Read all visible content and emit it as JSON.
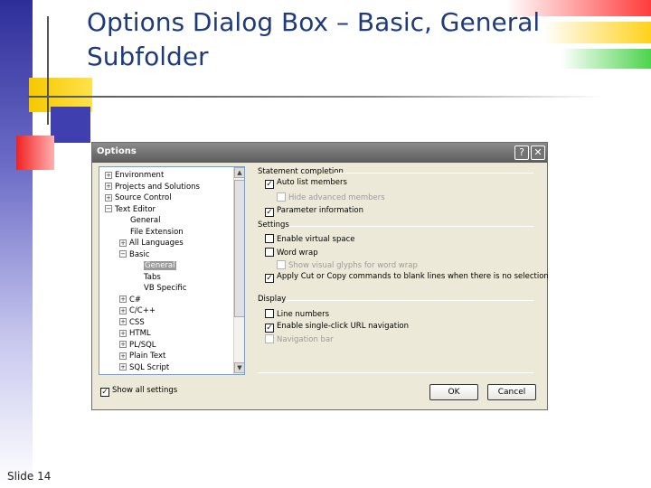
{
  "slide": {
    "title": "Options Dialog Box – Basic, General Subfolder",
    "footer": "Slide 14"
  },
  "dialog": {
    "title": "Options",
    "help_label": "?",
    "close_label": "✕",
    "tree": [
      {
        "label": "Environment",
        "expander": "+"
      },
      {
        "label": "Projects and Solutions",
        "expander": "+"
      },
      {
        "label": "Source Control",
        "expander": "+"
      },
      {
        "label": "Text Editor",
        "expander": "−"
      },
      {
        "label": "General",
        "expander": ""
      },
      {
        "label": "File Extension",
        "expander": ""
      },
      {
        "label": "All Languages",
        "expander": "+"
      },
      {
        "label": "Basic",
        "expander": "−"
      },
      {
        "label": "General",
        "expander": "",
        "selected": true
      },
      {
        "label": "Tabs",
        "expander": ""
      },
      {
        "label": "VB Specific",
        "expander": ""
      },
      {
        "label": "C#",
        "expander": "+"
      },
      {
        "label": "C/C++",
        "expander": "+"
      },
      {
        "label": "CSS",
        "expander": "+"
      },
      {
        "label": "HTML",
        "expander": "+"
      },
      {
        "label": "PL/SQL",
        "expander": "+"
      },
      {
        "label": "Plain Text",
        "expander": "+"
      },
      {
        "label": "SQL Script",
        "expander": "+"
      }
    ],
    "scroll_up": "▲",
    "scroll_down": "▼",
    "groups": {
      "statement_completion": "Statement completion",
      "settings": "Settings",
      "display": "Display"
    },
    "options": {
      "auto_list_members": {
        "label": "Auto list members",
        "checked": true
      },
      "hide_advanced_members": {
        "label": "Hide advanced members",
        "checked": false,
        "enabled": false
      },
      "parameter_information": {
        "label": "Parameter information",
        "checked": true
      },
      "enable_virtual_space": {
        "label": "Enable virtual space",
        "checked": false
      },
      "word_wrap": {
        "label": "Word wrap",
        "checked": false
      },
      "show_visual_glyphs": {
        "label": "Show visual glyphs for word wrap",
        "checked": false,
        "enabled": false
      },
      "apply_cut_copy": {
        "label": "Apply Cut or Copy commands to blank lines when there is no selection",
        "checked": true
      },
      "line_numbers": {
        "label": "Line numbers",
        "checked": false
      },
      "single_click_url": {
        "label": "Enable single-click URL navigation",
        "checked": true
      },
      "navigation_bar": {
        "label": "Navigation bar",
        "checked": false,
        "enabled": false
      }
    },
    "show_all_settings": {
      "label": "Show all settings",
      "checked": true
    },
    "ok_label": "OK",
    "cancel_label": "Cancel"
  },
  "colors": {
    "title_text": "#1f3b7a",
    "dialog_face": "#ece9d8",
    "titlebar": "#6e6e6e"
  }
}
